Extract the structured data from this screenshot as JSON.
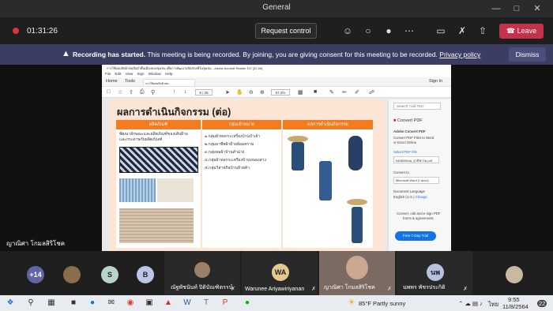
{
  "window": {
    "title": "General"
  },
  "call": {
    "timer": "01:31:26",
    "request_control": "Request control",
    "leave": "Leave"
  },
  "banner": {
    "bold": "Recording has started.",
    "text": "This meeting is being recorded. By joining, you are giving consent for this meeting to be recorded.",
    "link": "Privacy policy",
    "dismiss": "Dismiss"
  },
  "acrobat": {
    "title": "การใช้ผลผลิตผ้าทอมือผ้าพื้นเมืองของชุมชน เพื่อการพัฒนาผลิตภัณฑ์ในชุมชน - Adobe Acrobat Reader DC (32-bit)",
    "menu": [
      "File",
      "Edit",
      "View",
      "Sign",
      "Window",
      "Help"
    ],
    "tabs": {
      "home": "Home",
      "tools": "Tools",
      "doc": "การใช้ผลผลิตผ้าทอ...",
      "sign_in": "Sign In"
    },
    "page_indicator": "9 / 26",
    "zoom": "67.2%"
  },
  "pdf": {
    "heading": "ผลการดำเนินกิจกรรม (ต่อ)",
    "columns": [
      "ผลิตภัณฑ์",
      "กลุ่มเป้าหมาย",
      "ผลการดำเนินกิจกรรม"
    ],
    "product_text": [
      "พัฒนาลักษณะและผลิตภัณฑ์ของเส้นฝ้าย",
      "และกระดาษกับผลิตภัณฑ์"
    ],
    "targets": [
      "๑.กลุ่มผ้าทอกระเหรี่ยงบ้านบ้าเจ้า",
      "๒.กลุ่มอาชีพผ้าฝ้ายย้อมคราม",
      "๓.กลุ่มทอผ้าบ้านคำม่วง",
      "๔.กลุ่มผ้าทอกระเหรี่ยงบ้านหนองสาง",
      "๕.กลุ่มวิสาหกิจบ้านห้วยค้า"
    ]
  },
  "right_pane": {
    "search": "Search 'Add Text'",
    "export_label": "Convert PDF",
    "adobe_convert": "Adobe Convert PDF",
    "desc": [
      "Convert PDF Files to Word",
      "or Excel Online"
    ],
    "select_file": "Select PDF File",
    "file_name": "64080964a_ยุวดีฟารม.pdf",
    "convert_to": "Convert to",
    "format": "Microsoft Word (*.docx)",
    "doc_lang": "Document Language",
    "lang": "English (U.S.)",
    "change": "Change",
    "promo": [
      "Convert, edit and e-sign PDF",
      "forms & agreements"
    ],
    "trial": "Free 7-Day Trial"
  },
  "presenter_name": "ญาณิศา โกมลสิริโชค",
  "participants": {
    "overflow": "+14",
    "bubbles": [
      "S",
      "B"
    ],
    "tiles": [
      {
        "name": "ณัฐพัชนันท์ ปิติบัณฑิตรรน์"
      },
      {
        "initials": "WA",
        "name": "Warunee Ariyawiriyanan"
      },
      {
        "name": "ญาณิศา โกมลสิริโชค"
      },
      {
        "initials": "นพ",
        "name": "นพพร พัชรประกิติ"
      }
    ]
  },
  "taskbar": {
    "weather": "85°F  Partly sunny",
    "lang": "ไทย",
    "time": "9:55",
    "date": "11/8/2564",
    "notif": "22"
  },
  "colors": {
    "leave": "#c4314b",
    "banner": "#3b3d63",
    "table_header": "#f47b20",
    "page_bg": "#fde5d6",
    "acrobat_blue": "#1473e6"
  }
}
